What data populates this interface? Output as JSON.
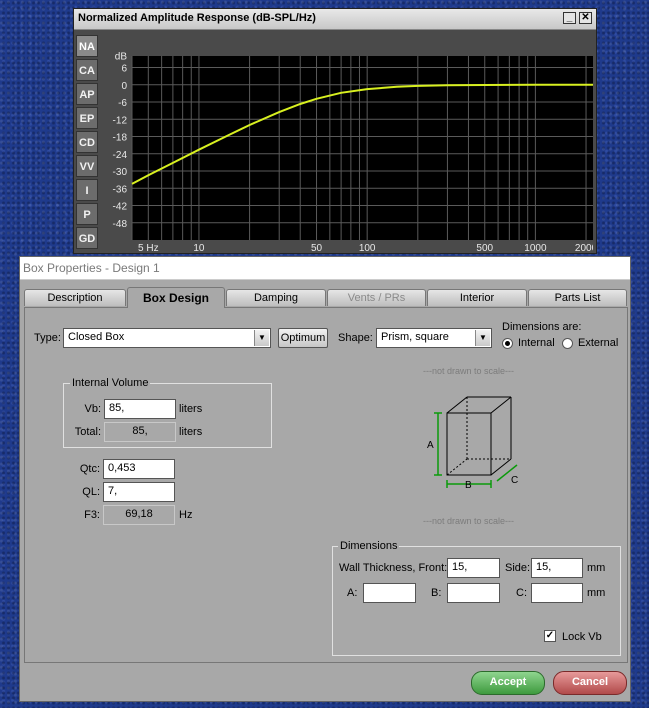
{
  "graph_window": {
    "title": "Normalized Amplitude Response (dB-SPL/Hz)",
    "minimize_label": "_",
    "close_label": "✕",
    "side_tabs": [
      "NA",
      "CA",
      "AP",
      "EP",
      "CD",
      "VV",
      "I",
      "P",
      "GD"
    ],
    "active_side_tab": "NA"
  },
  "chart_data": {
    "type": "line",
    "title": "Normalized Amplitude Response (dB-SPL/Hz)",
    "ylabel": "dB",
    "xlabel": "",
    "x_scale": "log",
    "xlim": [
      4,
      2200
    ],
    "ylim": [
      -54,
      10
    ],
    "yticks": [
      "dB",
      "6",
      "0",
      "-6",
      "-12",
      "-18",
      "-24",
      "-30",
      "-36",
      "-42",
      "-48"
    ],
    "ytick_values": [
      6,
      0,
      -6,
      -12,
      -18,
      -24,
      -30,
      -36,
      -42,
      -48
    ],
    "xticks": [
      {
        "value": 5,
        "label": "5 Hz"
      },
      {
        "value": 10,
        "label": "10"
      },
      {
        "value": 50,
        "label": "50"
      },
      {
        "value": 100,
        "label": "100"
      },
      {
        "value": 500,
        "label": "500"
      },
      {
        "value": 1000,
        "label": "1000"
      },
      {
        "value": 2000,
        "label": "2000"
      }
    ],
    "grid": true,
    "line_color": "#d8f020",
    "series": [
      {
        "x": [
          4,
          5,
          7,
          10,
          15,
          20,
          30,
          40,
          50,
          70,
          100,
          150,
          200,
          300,
          500,
          1000,
          2200
        ],
        "values": [
          -34.5,
          -31.5,
          -27.2,
          -22.6,
          -17.5,
          -14,
          -9.5,
          -6.7,
          -4.9,
          -2.8,
          -1.5,
          -0.7,
          -0.4,
          -0.2,
          -0.1,
          0,
          0
        ]
      }
    ]
  },
  "dialog": {
    "title": "Box Properties - Design 1",
    "tabs": [
      "Description",
      "Box Design",
      "Damping",
      "Vents / PRs",
      "Interior",
      "Parts List"
    ],
    "type_label": "Type:",
    "type_value": "Closed Box",
    "optimum_label": "Optimum",
    "shape_label": "Shape:",
    "shape_value": "Prism, square",
    "dimensions_are_label": "Dimensions are:",
    "internal_label": "Internal",
    "external_label": "External",
    "internal_volume_title": "Internal Volume",
    "vb_label": "Vb:",
    "vb_value": "85,",
    "vb_unit": "liters",
    "total_label": "Total:",
    "total_value": "85,",
    "total_unit": "liters",
    "qtc_label": "Qtc:",
    "qtc_value": "0,453",
    "ql_label": "QL:",
    "ql_value": "7,",
    "f3_label": "F3:",
    "f3_value": "69,18",
    "f3_unit": "Hz",
    "not_to_scale_top": "---not drawn to scale---",
    "not_to_scale_bottom": "---not drawn to scale---",
    "diagram_labels": {
      "a": "A",
      "b": "B",
      "c": "C"
    },
    "dimensions_title": "Dimensions",
    "wall_front_label": "Wall Thickness, Front:",
    "wall_front_value": "15,",
    "side_label": "Side:",
    "side_value": "15,",
    "mm_unit": "mm",
    "a_label": "A:",
    "a_value": "",
    "b_label": "B:",
    "b_value": "",
    "c_label": "C:",
    "c_value": "",
    "mm_unit2": "mm",
    "lock_vb_label": "Lock Vb",
    "accept_label": "Accept",
    "cancel_label": "Cancel"
  }
}
